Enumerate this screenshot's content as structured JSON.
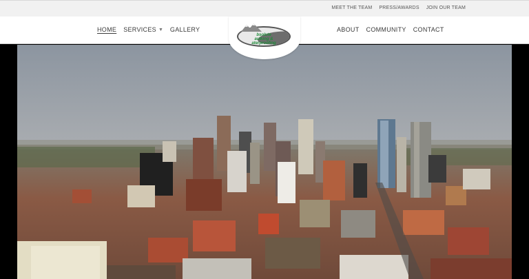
{
  "top_links": [
    "MEET THE TEAM",
    "PRESS/AWARDS",
    "JOIN OUR TEAM"
  ],
  "nav_left": [
    {
      "label": "HOME",
      "active": true
    },
    {
      "label": "SERVICES",
      "dropdown": true
    },
    {
      "label": "GALLERY"
    }
  ],
  "nav_right": [
    {
      "label": "ABOUT"
    },
    {
      "label": "COMMUNITY"
    },
    {
      "label": "CONTACT"
    }
  ],
  "logo": {
    "line1": "bsolute",
    "line2": "aulking &",
    "line3": "aterproofing"
  },
  "colors": {
    "topbar_bg": "#f1f1f1",
    "nav_bg": "#ffffff",
    "logo_green": "#1f8b3a",
    "sky_top": "#8d96a1",
    "sky_bottom": "#c9c7c3"
  },
  "hero_icon": "city-skyline-photo"
}
